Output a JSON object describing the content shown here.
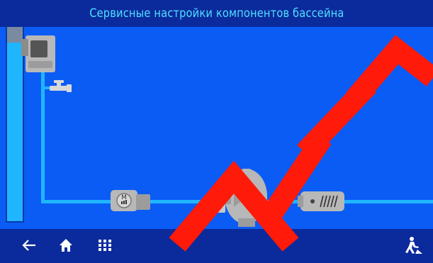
{
  "header": {
    "title": "Сервисные настройки компонентов бассейна"
  },
  "colors": {
    "header_bg": "#0b2a9c",
    "screen_bg": "#0a5cf5",
    "title_text": "#4fe0ff",
    "pipe": "#1fb6ff",
    "pool_water": "#1fb6ff",
    "component_grey": "#b8b8b8",
    "footer_icon": "#ffffff"
  },
  "components": [
    {
      "name": "skimmer",
      "icon": "skimmer-icon"
    },
    {
      "name": "drain-valve",
      "icon": "tap-icon"
    },
    {
      "name": "pump",
      "icon": "pump-icon"
    },
    {
      "name": "filter",
      "icon": "filter-icon"
    },
    {
      "name": "heater",
      "icon": "heater-icon"
    }
  ],
  "footer": {
    "buttons": [
      {
        "icon": "arrow-left-icon"
      },
      {
        "icon": "home-icon"
      },
      {
        "icon": "grid-menu-icon"
      },
      {
        "icon": "service-worker-icon"
      }
    ]
  }
}
